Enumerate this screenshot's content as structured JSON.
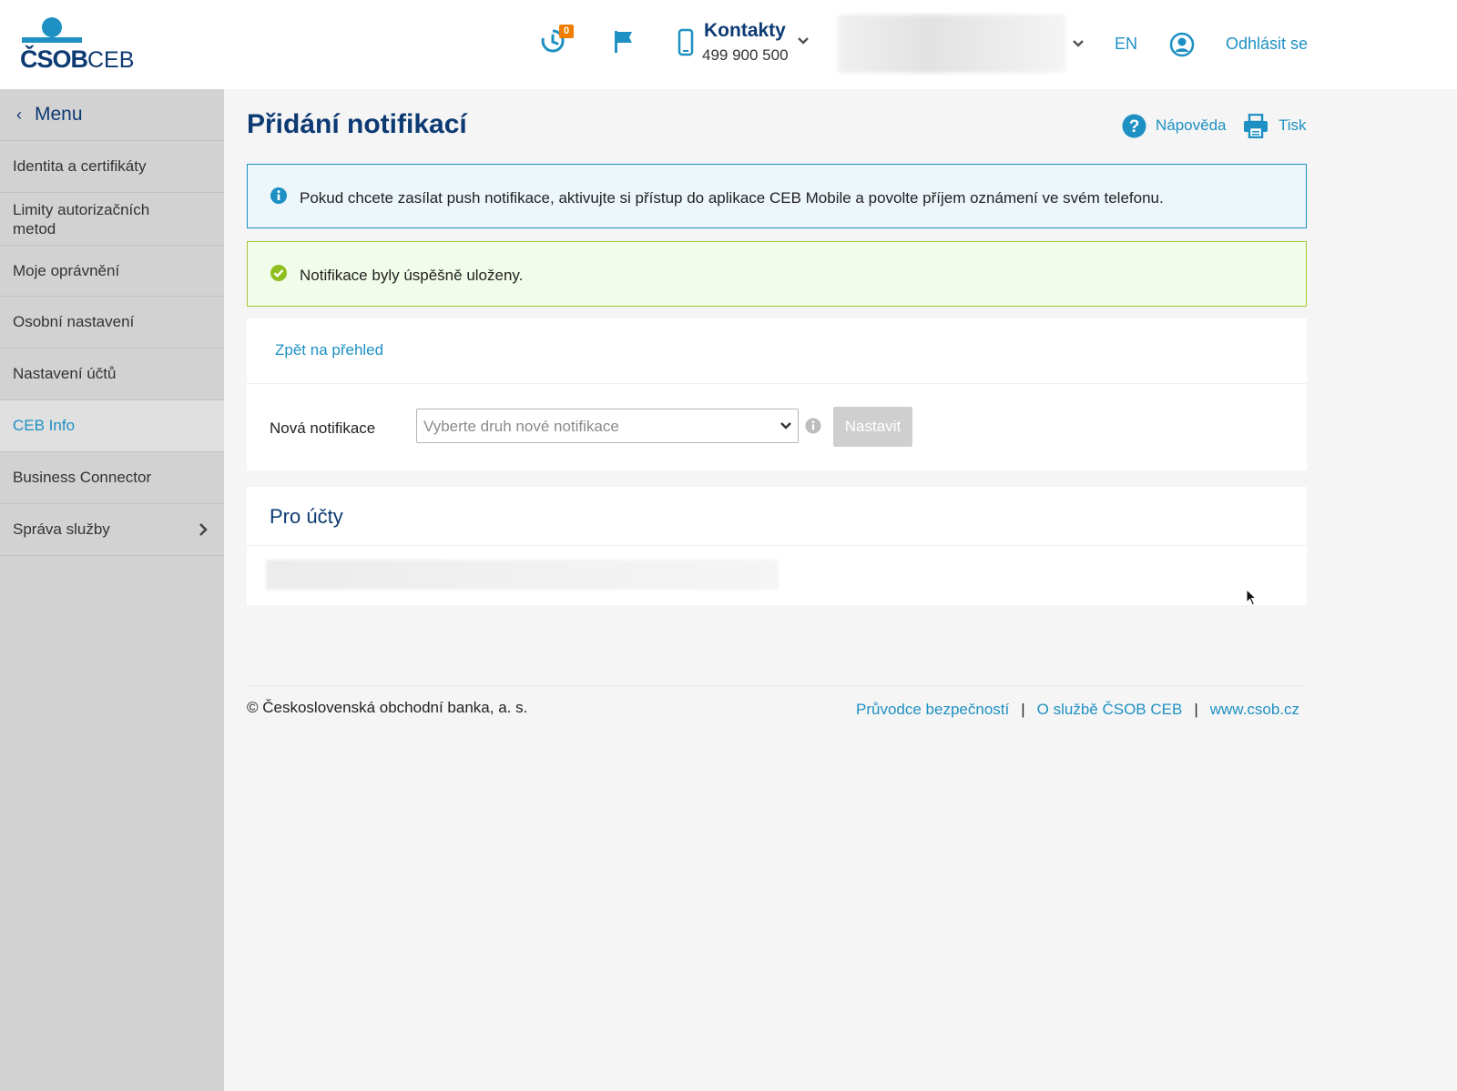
{
  "header": {
    "logo": {
      "brand": "ČSOB",
      "product": "CEB"
    },
    "history_badge": "0",
    "contacts": {
      "title": "Kontakty",
      "phone": "499 900 500"
    },
    "language": "EN",
    "logout": "Odhlásit se"
  },
  "sidebar": {
    "menu_label": "Menu",
    "items": [
      {
        "label": "Identita a certifikáty",
        "active": false
      },
      {
        "label": "Limity autorizačních metod",
        "active": false
      },
      {
        "label": "Moje oprávnění",
        "active": false
      },
      {
        "label": "Osobní nastavení",
        "active": false
      },
      {
        "label": "Nastavení účtů",
        "active": false
      },
      {
        "label": "CEB Info",
        "active": true
      },
      {
        "label": "Business Connector",
        "active": false
      },
      {
        "label": "Správa služby",
        "active": false,
        "has_submenu": true
      }
    ]
  },
  "main": {
    "title": "Přidání notifikací",
    "help_label": "Nápověda",
    "print_label": "Tisk",
    "info_alert": "Pokud chcete zasílat push notifikace, aktivujte si přístup do aplikace CEB Mobile a povolte příjem oznámení ve svém telefonu.",
    "success_alert": "Notifikace byly úspěšně uloženy.",
    "back_link": "Zpět na přehled",
    "new_notification": {
      "label": "Nová notifikace",
      "placeholder": "Vyberte druh nové notifikace",
      "button": "Nastavit"
    },
    "accounts_section": {
      "title": "Pro účty"
    }
  },
  "footer": {
    "copyright": "© Československá obchodní banka, a. s.",
    "links": [
      "Průvodce bezpečností",
      "O službě ČSOB CEB",
      "www.csob.cz"
    ],
    "separator": "|"
  },
  "colors": {
    "brand_blue": "#0d3a73",
    "link_blue": "#1e90c3",
    "badge_orange": "#f07d00",
    "success_green": "#8fbf1f"
  }
}
